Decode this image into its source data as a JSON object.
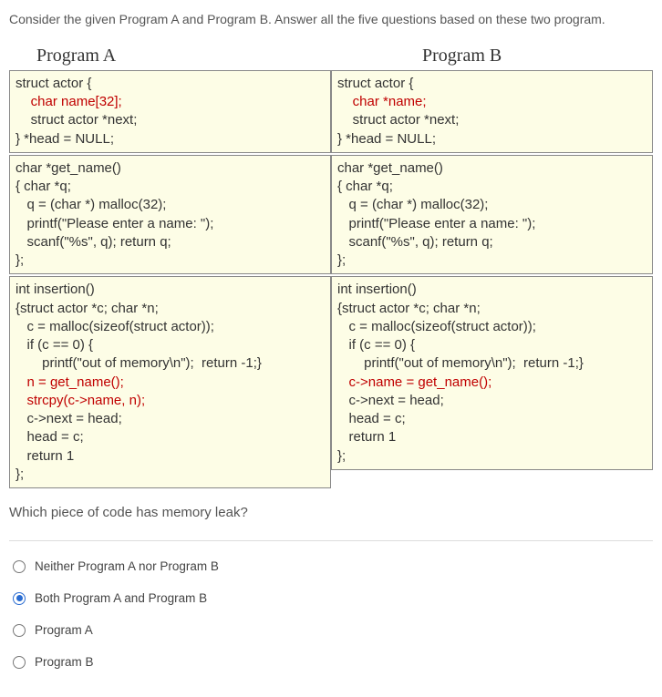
{
  "intro": "Consider the given Program A and Program B. Answer all the five questions based on these two program.",
  "programA": {
    "title": "Program A",
    "block1": {
      "l1": "struct actor {",
      "l2": "    char name[32];",
      "l3": "    struct actor *next;",
      "l4": "} *head = NULL;"
    },
    "block2": {
      "l1": "char *get_name()",
      "l2": "{ char *q;",
      "l3": "   q = (char *) malloc(32);",
      "l4": "   printf(\"Please enter a name: \");",
      "l5": "   scanf(\"%s\", q); return q;",
      "l6": "};"
    },
    "block3": {
      "l1": "int insertion()",
      "l2": "{struct actor *c; char *n;",
      "l3": "   c = malloc(sizeof(struct actor));",
      "l4": "   if (c == 0) {",
      "l5": "       printf(\"out of memory\\n\");  return -1;}",
      "l6": "   n = get_name();",
      "l7": "   strcpy(c->name, n);",
      "l8": "   c->next = head;",
      "l9": "   head = c;",
      "l10": "   return 1",
      "l11": "};"
    }
  },
  "programB": {
    "title": "Program B",
    "block1": {
      "l1": "struct actor {",
      "l2": "    char *name;",
      "l3": "    struct actor *next;",
      "l4": "} *head = NULL;"
    },
    "block2": {
      "l1": "char *get_name()",
      "l2": "{ char *q;",
      "l3": "   q = (char *) malloc(32);",
      "l4": "   printf(\"Please enter a name: \");",
      "l5": "   scanf(\"%s\", q); return q;",
      "l6": "};"
    },
    "block3": {
      "l1": "int insertion()",
      "l2": "{struct actor *c; char *n;",
      "l3": "   c = malloc(sizeof(struct actor));",
      "l4": "   if (c == 0) {",
      "l5": "       printf(\"out of memory\\n\");  return -1;}",
      "l6": "   c->name = get_name();",
      "l7": "   c->next = head;",
      "l8": "   head = c;",
      "l9": "   return 1",
      "l10": "};"
    }
  },
  "question": "Which piece of code has memory leak?",
  "options": {
    "a": "Neither Program A nor Program  B",
    "b": "Both Program A and Program B",
    "c": "Program A",
    "d": "Program B"
  },
  "selected": "b"
}
